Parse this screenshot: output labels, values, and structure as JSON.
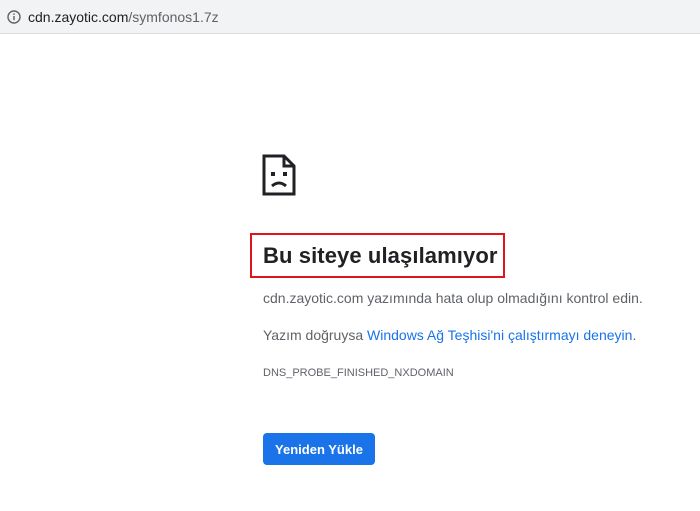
{
  "address_bar": {
    "host": "cdn.zayotic.com",
    "path": "/symfonos1.7z",
    "info_icon": "info-icon"
  },
  "error_page": {
    "icon": "sad-page-icon",
    "title": "Bu siteye ulaşılamıyor",
    "message_1": "cdn.zayotic.com yazımında hata olup olmadığını kontrol edin.",
    "message_2_prefix": "Yazım doğruysa ",
    "message_2_link": "Windows Ağ Teşhisi'ni çalıştırmayı deneyin",
    "message_2_suffix": ".",
    "error_code": "DNS_PROBE_FINISHED_NXDOMAIN",
    "reload_label": "Yeniden Yükle",
    "highlight_color": "#e0141e",
    "link_color": "#1a73e8",
    "button_color": "#1a73e8"
  }
}
